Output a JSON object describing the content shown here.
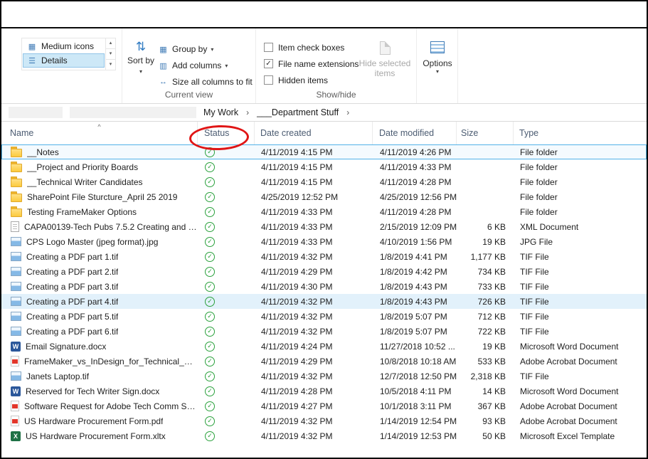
{
  "glyphs": {
    "chevron_down": "▾",
    "breadcrumb_separator": "›",
    "sort_caret": "^",
    "check": "✓",
    "scroll_up": "▴",
    "scroll_down": "▾",
    "gallery_more": "▾",
    "sort_icon": "⇅",
    "medium_icons_icon": "▦",
    "details_icon": "☰",
    "group_by_icon": "▦",
    "add_columns_icon": "▥",
    "size_columns_icon": "↔",
    "word_letter": "W",
    "excel_letter": "X"
  },
  "ribbon": {
    "layout_gallery": {
      "items": [
        {
          "label": "Medium icons",
          "selected": false
        },
        {
          "label": "Details",
          "selected": true
        }
      ]
    },
    "current_view": {
      "sort_by_label": "Sort by",
      "group_by_label": "Group by",
      "add_columns_label": "Add columns",
      "size_columns_label": "Size all columns to fit",
      "group_label": "Current view"
    },
    "show_hide": {
      "checkboxes": [
        {
          "label": "Item check boxes",
          "checked": false
        },
        {
          "label": "File name extensions",
          "checked": true
        },
        {
          "label": "Hidden items",
          "checked": false
        }
      ],
      "hide_selected_label": "Hide selected items",
      "group_label": "Show/hide"
    },
    "options_label": "Options"
  },
  "breadcrumb": {
    "items": [
      "My Work",
      "___Department Stuff"
    ]
  },
  "annotation": {
    "circled_column": "Status"
  },
  "table": {
    "columns": [
      "Name",
      "Status",
      "Date created",
      "Date modified",
      "Size",
      "Type"
    ],
    "rows": [
      {
        "name": "__Notes",
        "icon": "folder",
        "status": "synced",
        "created": "4/11/2019 4:15 PM",
        "modified": "4/11/2019 4:26 PM",
        "size": "",
        "type": "File folder",
        "selected": true
      },
      {
        "name": "__Project and Priority Boards",
        "icon": "folder",
        "status": "synced",
        "created": "4/11/2019 4:15 PM",
        "modified": "4/11/2019 4:33 PM",
        "size": "",
        "type": "File folder"
      },
      {
        "name": "__Technical Writer Candidates",
        "icon": "folder",
        "status": "synced",
        "created": "4/11/2019 4:15 PM",
        "modified": "4/11/2019 4:28 PM",
        "size": "",
        "type": "File folder"
      },
      {
        "name": "SharePoint File Sturcture_April 25 2019",
        "icon": "folder",
        "status": "synced",
        "created": "4/25/2019 12:52 PM",
        "modified": "4/25/2019 12:56 PM",
        "size": "",
        "type": "File folder"
      },
      {
        "name": "Testing FrameMaker Options",
        "icon": "folder",
        "status": "synced",
        "created": "4/11/2019 4:33 PM",
        "modified": "4/11/2019 4:28 PM",
        "size": "",
        "type": "File folder"
      },
      {
        "name": "CAPA00139-Tech Pubs 7.5.2 Creating and u...",
        "icon": "xml",
        "status": "synced",
        "created": "4/11/2019 4:33 PM",
        "modified": "2/15/2019 12:09 PM",
        "size": "6 KB",
        "type": "XML Document"
      },
      {
        "name": "CPS Logo Master (jpeg format).jpg",
        "icon": "image",
        "status": "synced",
        "created": "4/11/2019 4:33 PM",
        "modified": "4/10/2019 1:56 PM",
        "size": "19 KB",
        "type": "JPG File"
      },
      {
        "name": "Creating a PDF part 1.tif",
        "icon": "image",
        "status": "synced",
        "created": "4/11/2019 4:32 PM",
        "modified": "1/8/2019 4:41 PM",
        "size": "1,177 KB",
        "type": "TIF File"
      },
      {
        "name": "Creating a PDF part 2.tif",
        "icon": "image",
        "status": "synced",
        "created": "4/11/2019 4:29 PM",
        "modified": "1/8/2019 4:42 PM",
        "size": "734 KB",
        "type": "TIF File"
      },
      {
        "name": "Creating a PDF part 3.tif",
        "icon": "image",
        "status": "synced",
        "created": "4/11/2019 4:30 PM",
        "modified": "1/8/2019 4:43 PM",
        "size": "733 KB",
        "type": "TIF File"
      },
      {
        "name": "Creating a PDF part 4.tif",
        "icon": "image",
        "status": "synced",
        "created": "4/11/2019 4:32 PM",
        "modified": "1/8/2019 4:43 PM",
        "size": "726 KB",
        "type": "TIF File",
        "highlighted": true
      },
      {
        "name": "Creating a PDF part 5.tif",
        "icon": "image",
        "status": "synced",
        "created": "4/11/2019 4:32 PM",
        "modified": "1/8/2019 5:07 PM",
        "size": "712 KB",
        "type": "TIF File"
      },
      {
        "name": "Creating a PDF part 6.tif",
        "icon": "image",
        "status": "synced",
        "created": "4/11/2019 4:32 PM",
        "modified": "1/8/2019 5:07 PM",
        "size": "722 KB",
        "type": "TIF File"
      },
      {
        "name": "Email Signature.docx",
        "icon": "word",
        "status": "synced",
        "created": "4/11/2019 4:24 PM",
        "modified": "11/27/2018 10:52 ...",
        "size": "19 KB",
        "type": "Microsoft Word Document"
      },
      {
        "name": "FrameMaker_vs_InDesign_for_Technical_Do...",
        "icon": "pdf",
        "status": "synced",
        "created": "4/11/2019 4:29 PM",
        "modified": "10/8/2018 10:18 AM",
        "size": "533 KB",
        "type": "Adobe Acrobat Document"
      },
      {
        "name": "Janets Laptop.tif",
        "icon": "image",
        "status": "synced",
        "created": "4/11/2019 4:32 PM",
        "modified": "12/7/2018 12:50 PM",
        "size": "2,318 KB",
        "type": "TIF File"
      },
      {
        "name": "Reserved for Tech Writer Sign.docx",
        "icon": "word",
        "status": "synced",
        "created": "4/11/2019 4:28 PM",
        "modified": "10/5/2018 4:11 PM",
        "size": "14 KB",
        "type": "Microsoft Word Document"
      },
      {
        "name": "Software Request for Adobe Tech Comm Su...",
        "icon": "pdf",
        "status": "synced",
        "created": "4/11/2019 4:27 PM",
        "modified": "10/1/2018 3:11 PM",
        "size": "367 KB",
        "type": "Adobe Acrobat Document"
      },
      {
        "name": "US Hardware Procurement Form.pdf",
        "icon": "pdf",
        "status": "synced",
        "created": "4/11/2019 4:32 PM",
        "modified": "1/14/2019 12:54 PM",
        "size": "93 KB",
        "type": "Adobe Acrobat Document"
      },
      {
        "name": "US Hardware Procurement Form.xltx",
        "icon": "excel",
        "status": "synced",
        "created": "4/11/2019 4:32 PM",
        "modified": "1/14/2019 12:53 PM",
        "size": "50 KB",
        "type": "Microsoft Excel Template"
      }
    ]
  }
}
